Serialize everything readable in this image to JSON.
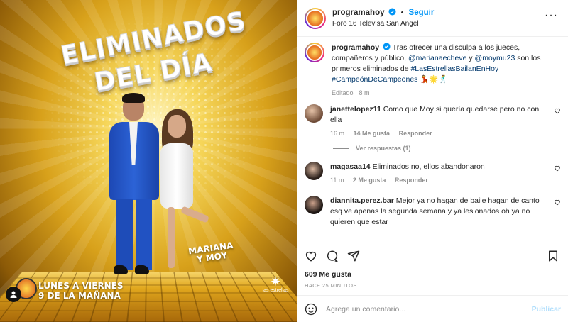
{
  "image": {
    "title_line1": "ELIMINADOS",
    "title_line2": "DEL DÍA",
    "couple_line1": "MARIANA",
    "couple_line2": "Y MOY",
    "schedule_line1": "LUNES A VIERNES",
    "schedule_line2": "9 DE LA MAÑANA",
    "network": "las estrellas"
  },
  "header": {
    "username": "programahoy",
    "dot": "•",
    "follow_label": "Seguir",
    "location": "Foro 16 Televisa San Angel",
    "more_icon": "more-horizontal-icon"
  },
  "caption": {
    "username": "programahoy",
    "text_1": "Tras ofrecer una disculpa a los jueces, compañeros y público, ",
    "mention_1": "@marianaecheve",
    "text_2": " y ",
    "mention_2": "@moymu23",
    "text_3": " son los primeros eliminados de ",
    "hashtag_1": "#LasEstrellasBailanEnHoy",
    "hashtag_2": "#CampeónDeCampeones",
    "emojis": "💃🌟🕺",
    "meta": "Editado · 8 m"
  },
  "comments": [
    {
      "username": "janettelopez11",
      "text": "Como que Moy si quería quedarse pero no con ella",
      "time": "16 m",
      "likes": "14 Me gusta",
      "reply": "Responder",
      "view_replies": "Ver respuestas (1)"
    },
    {
      "username": "magasaa14",
      "text": "Eliminados no, ellos abandonaron",
      "time": "11 m",
      "likes": "2 Me gusta",
      "reply": "Responder"
    },
    {
      "username": "diannita.perez.bar",
      "text": "Mejor ya no hagan de baile hagan de canto esq ve apenas la segunda semana y ya lesionados oh ya no quieren que estar",
      "time": "",
      "likes": "",
      "reply": ""
    }
  ],
  "stats": {
    "likes": "609 Me gusta",
    "time_ago": "HACE 25 MINUTOS"
  },
  "composer": {
    "placeholder": "Agrega un comentario...",
    "publish_label": "Publicar"
  },
  "colors": {
    "accent": "#0095f6",
    "publish_disabled": "#b2dffc",
    "muted": "#8e8e8e"
  }
}
